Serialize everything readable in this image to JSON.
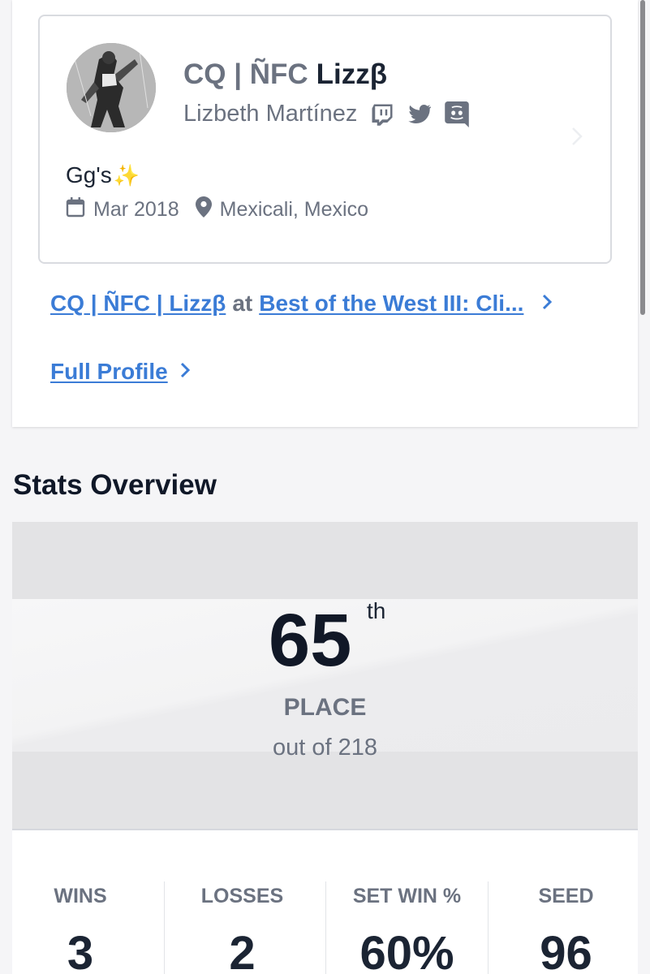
{
  "profile": {
    "tag_prefix": "CQ | ÑFC",
    "gamer_tag": "Lizzβ",
    "real_name": "Lizbeth Martínez",
    "bio": "Gg's",
    "bio_emoji": "✨",
    "joined": "Mar 2018",
    "location": "Mexicali, Mexico",
    "social_icons": [
      "twitch-icon",
      "twitter-icon",
      "discord-icon"
    ]
  },
  "links": {
    "entrant": "CQ | ÑFC | Lizzβ",
    "at": "at",
    "event": "Best of the West III: Cli...",
    "full_profile": "Full Profile"
  },
  "stats": {
    "title": "Stats Overview",
    "place": "65",
    "place_suffix": "th",
    "place_label": "PLACE",
    "out_of": "out of 218",
    "items": [
      {
        "label": "WINS",
        "value": "3"
      },
      {
        "label": "LOSSES",
        "value": "2"
      },
      {
        "label": "SET WIN %",
        "value": "60%"
      },
      {
        "label": "SEED",
        "value": "96"
      }
    ]
  },
  "colors": {
    "link": "#3b7cd6",
    "muted": "#6b7280",
    "text": "#1b2433"
  }
}
